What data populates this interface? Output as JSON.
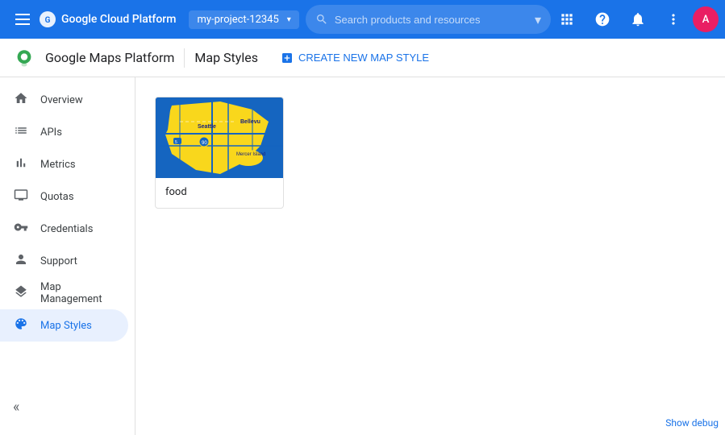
{
  "topbar": {
    "title": "Google Cloud Platform",
    "menu_icon": "menu-icon",
    "project_name": "my-project-12345",
    "search_placeholder": "Search products and resources",
    "icons": {
      "apps": "⊞",
      "help": "?",
      "notifications": "🔔",
      "more": "⋮"
    },
    "avatar_letter": "A"
  },
  "subheader": {
    "app_name": "Google Maps Platform",
    "page_title": "Map Styles",
    "create_button": "CREATE NEW MAP STYLE"
  },
  "sidebar": {
    "items": [
      {
        "id": "overview",
        "label": "Overview",
        "icon": "home"
      },
      {
        "id": "apis",
        "label": "APIs",
        "icon": "list"
      },
      {
        "id": "metrics",
        "label": "Metrics",
        "icon": "bar-chart"
      },
      {
        "id": "quotas",
        "label": "Quotas",
        "icon": "monitor"
      },
      {
        "id": "credentials",
        "label": "Credentials",
        "icon": "key"
      },
      {
        "id": "support",
        "label": "Support",
        "icon": "person"
      },
      {
        "id": "map-management",
        "label": "Map Management",
        "icon": "layers"
      },
      {
        "id": "map-styles",
        "label": "Map Styles",
        "icon": "palette",
        "active": true
      }
    ],
    "collapse_icon": "«"
  },
  "content": {
    "map_styles": [
      {
        "id": "food",
        "name": "food"
      }
    ]
  },
  "footer": {
    "debug_link": "Show debug"
  }
}
